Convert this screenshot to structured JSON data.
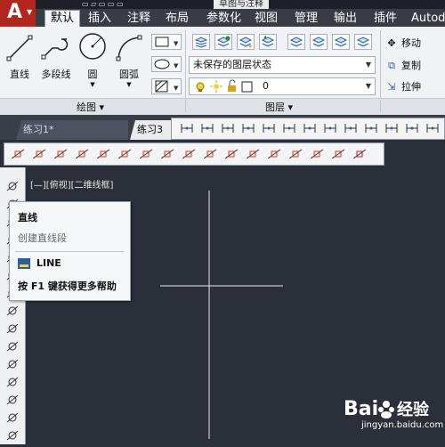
{
  "window": {
    "doc_title": "草图与注释",
    "app_letter": "A",
    "quick_access": "▭  ▱  ▭  ▭  ▭"
  },
  "ribbon_tabs": [
    "默认",
    "插入",
    "注释",
    "布局",
    "参数化",
    "视图",
    "管理",
    "输出",
    "插件",
    "Autode"
  ],
  "draw_panel": {
    "title": "绘图",
    "tools": [
      "直线",
      "多段线",
      "圆",
      "圆弧"
    ]
  },
  "layers_panel": {
    "title": "图层",
    "layer_state": "未保存的图层状态",
    "current_layer": "0"
  },
  "modify_panel": {
    "tools": [
      "移动",
      "复制",
      "拉伸"
    ]
  },
  "doc_tabs": [
    "练习1*",
    "练习3"
  ],
  "viewport_label": "[—][俯视][二维线框]",
  "tooltip": {
    "title": "直线",
    "description": "创建直线段",
    "command": "LINE",
    "help": "按 F1 键获得更多帮助"
  },
  "watermark": {
    "brand": "Bai经验",
    "url": "jingyan.baidu.com"
  }
}
